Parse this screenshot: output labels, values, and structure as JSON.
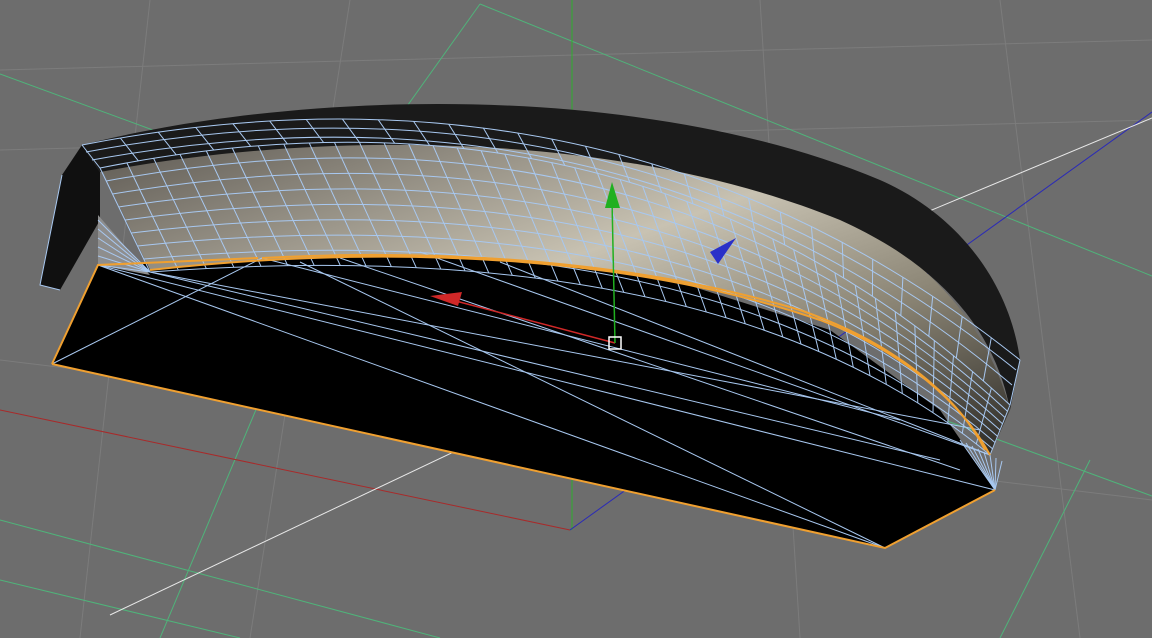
{
  "viewport": {
    "background_color": "#6d6d6d"
  },
  "scene": {
    "grid": {
      "minor_color": "#7e7e7e",
      "major_color": "#4fb47a",
      "x_axis_color": "#a82a2a",
      "y_axis_color": "#2db02d",
      "z_axis_color": "#2a2ab8",
      "extra_axis_color": "#e8e8e8"
    },
    "object": {
      "solid_color": "#000000",
      "selection_outline_color": "#f0a030",
      "wireframe_color": "#a8c8f0",
      "shaded_surface_color": "#b0aa9c"
    },
    "gizmo": {
      "x_arrow_color": "#d02828",
      "y_arrow_color": "#20b020",
      "z_arrow_color": "#2a30c8",
      "pivot_icon": "pivot-box-icon"
    }
  }
}
